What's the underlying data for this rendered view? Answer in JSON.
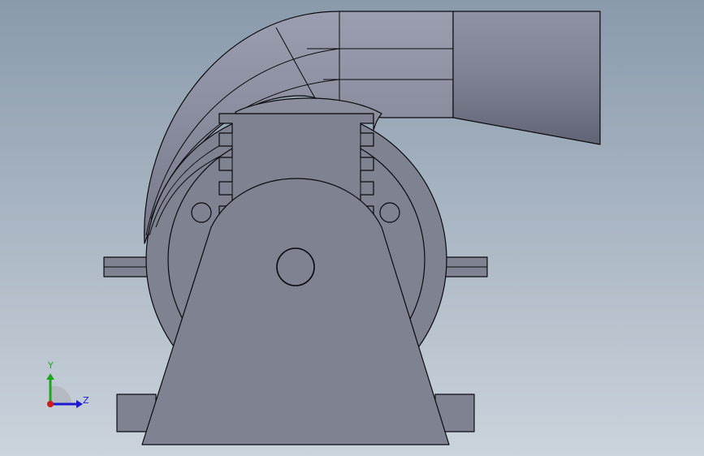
{
  "viewport": {
    "background_top": "#8a9aab",
    "background_bottom": "#cbd3dc",
    "model_fill": "#7e8291",
    "model_stroke": "#0a0a10"
  },
  "triad": {
    "y_label": "Y",
    "z_label": "Z",
    "y_color": "#1aa81a",
    "z_color": "#1a1ad0",
    "x_color": "#d01a1a"
  }
}
